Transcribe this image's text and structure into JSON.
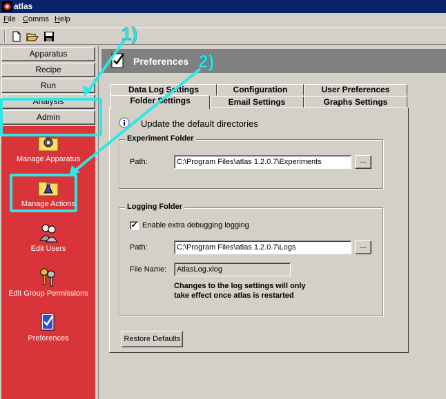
{
  "window": {
    "title": "atlas"
  },
  "menu": {
    "file": "File",
    "comms": "Comms",
    "help": "Help"
  },
  "toolbar": {
    "new_icon": "new-document-icon",
    "open_icon": "open-folder-icon",
    "save_icon": "save-disk-icon"
  },
  "nav": {
    "apparatus": "Apparatus",
    "recipe": "Recipe",
    "run": "Run",
    "analysis": "Analysis",
    "admin": "Admin"
  },
  "actions": {
    "manage_apparatus": "Manage Apparatus",
    "manage_actions": "Manage Actions",
    "edit_users": "Edit Users",
    "edit_group_permissions": "Edit Group Permissions",
    "preferences": "Preferences"
  },
  "header": {
    "title": "Preferences"
  },
  "tabs": {
    "data_log_settings": "Data Log Settings",
    "configuration": "Configuration",
    "user_preferences": "User Preferences",
    "folder_settings": "Folder Settings",
    "email_settings": "Email Settings",
    "graphs_settings": "Graphs Settings"
  },
  "folder_settings": {
    "info_text": "Update the default directories",
    "experiment": {
      "title": "Experiment Folder",
      "path_label": "Path:",
      "path_value": "C:\\Program Files\\atlas 1.2.0.7\\Experiments",
      "browse_label": "..."
    },
    "logging": {
      "title": "Logging Folder",
      "checkbox_label": "Enable extra debugging logging",
      "checkbox_mark": "✔",
      "path_label": "Path:",
      "path_value": "C:\\Program Files\\atlas 1.2.0.7\\Logs",
      "browse_label": "...",
      "filename_label": "File Name:",
      "filename_value": "AtlasLog.xlog",
      "note_line1": "Changes to the log settings will only",
      "note_line2": "take effect once atlas is restarted"
    },
    "restore_defaults": "Restore Defaults"
  },
  "annotations": {
    "step1": "1)",
    "step2": "2)",
    "highlight_color": "#2ee6e6"
  }
}
